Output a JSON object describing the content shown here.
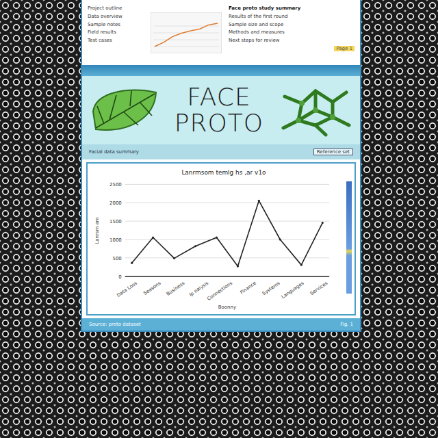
{
  "document": {
    "header": {
      "left_lines": [
        "Project outline",
        "Data overview",
        "Sample notes",
        "Field results",
        "Test cases"
      ],
      "mini_chart": {
        "values": [
          2,
          2.5,
          3.2,
          3.6,
          3.9,
          4.1,
          4.6,
          4.8
        ]
      },
      "right_lines": [
        "Face proto study summary",
        "Results of the first round",
        "Sample size and scope",
        "Methods and measures",
        "Next steps for review"
      ],
      "status": "Page 1"
    },
    "banner": {
      "title_line1": "FACE",
      "title_line2": "PROTO"
    },
    "caption": {
      "left": "Facial data summary",
      "right": "Reference set"
    },
    "chart": {
      "title": "Lanrmsom temlg hs ,ar v1o",
      "y_axis_title": "Lanrsm am",
      "x_axis_title": "Boonny",
      "y_ticks": [
        "0",
        "500",
        "1000",
        "1500",
        "2000",
        "2500"
      ],
      "x_labels": [
        "Data Loss",
        "Seasons",
        "Business",
        "Ip nalysis",
        "Connections",
        "Finance",
        "Systems",
        "Languages",
        "Services"
      ],
      "values": [
        364,
        1055,
        491,
        818,
        1055,
        273,
        2055,
        1000,
        309,
        1455
      ]
    },
    "footer": {
      "left": "Source: proto dataset",
      "right": "Fig. 1"
    }
  }
}
